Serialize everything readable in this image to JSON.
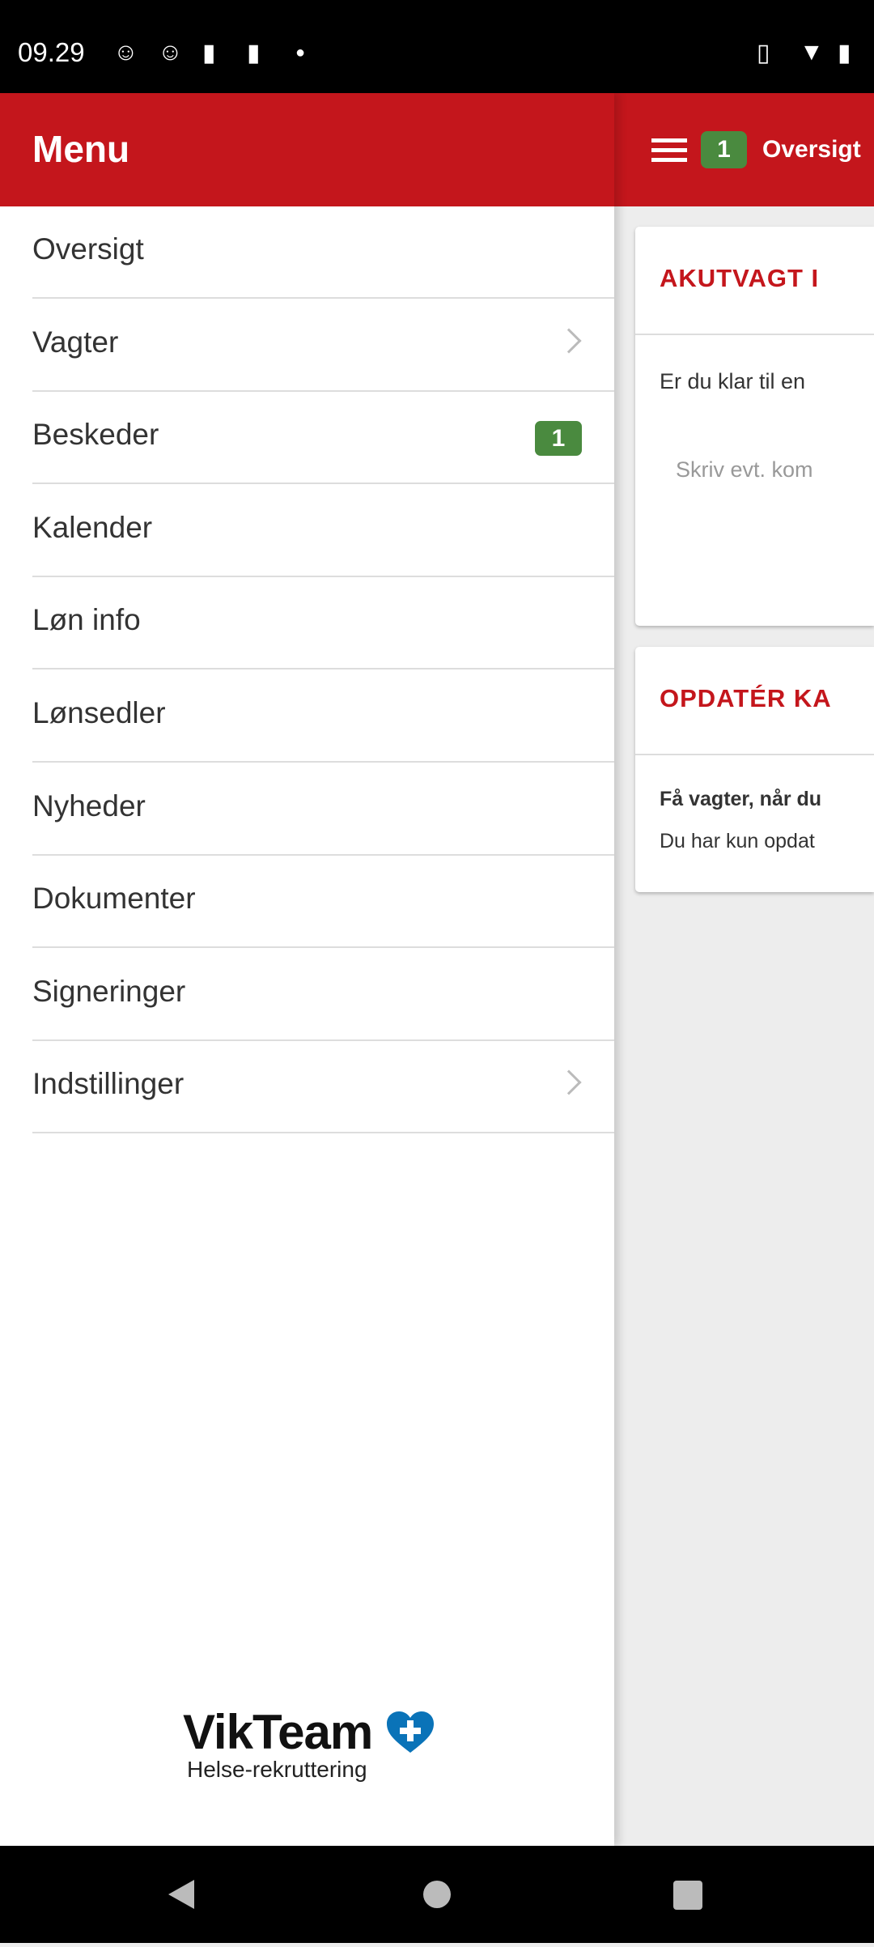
{
  "status_bar": {
    "time": "09.29"
  },
  "header": {
    "menu_badge": "1",
    "title": "Oversigt"
  },
  "drawer": {
    "title": "Menu",
    "items": [
      {
        "label": "Oversigt"
      },
      {
        "label": "Vagter",
        "chevron": true
      },
      {
        "label": "Beskeder",
        "badge": "1"
      },
      {
        "label": "Kalender"
      },
      {
        "label": "Løn info"
      },
      {
        "label": "Lønsedler"
      },
      {
        "label": "Nyheder"
      },
      {
        "label": "Dokumenter"
      },
      {
        "label": "Signeringer"
      },
      {
        "label": "Indstillinger",
        "chevron": true
      }
    ],
    "logo": {
      "name": "VikTeam",
      "tagline": "Helse-rekruttering"
    }
  },
  "cards": [
    {
      "title": "AKUTVAGT I",
      "text": "Er du klar til en",
      "placeholder": "Skriv evt. kom"
    },
    {
      "title": "OPDATÉR KA",
      "bold": "Få vagter, når du",
      "text": "Du har kun opdat"
    }
  ],
  "colors": {
    "brand": "#c4161c",
    "badge": "#4a8a3f",
    "logo_heart": "#0a73b8"
  }
}
